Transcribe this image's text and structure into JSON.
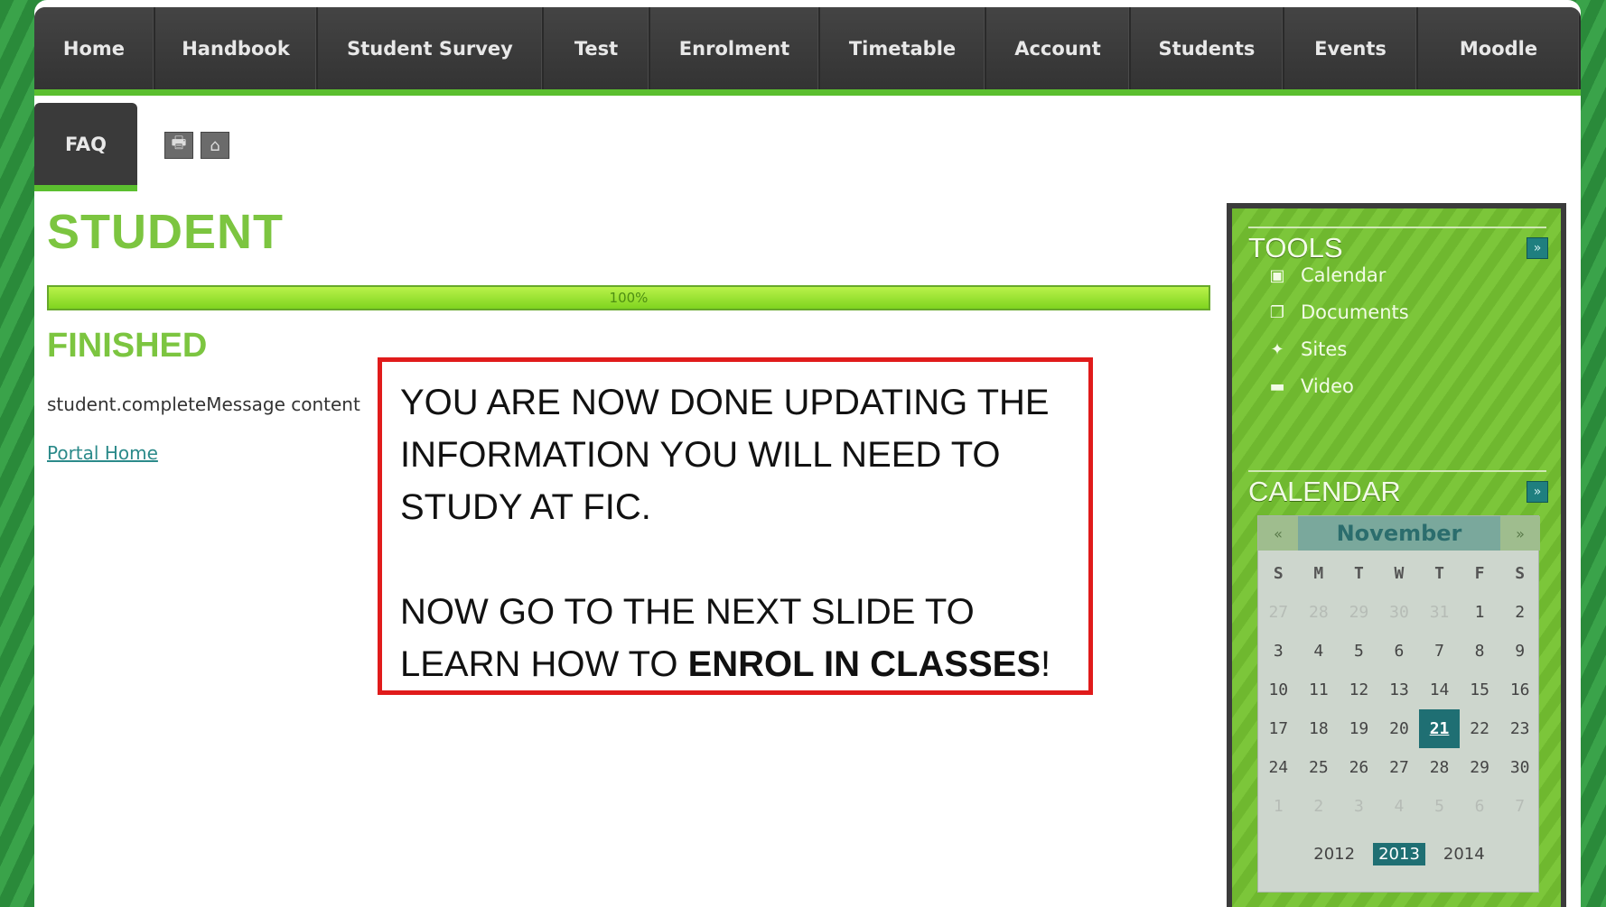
{
  "nav": {
    "items": [
      "Home",
      "Handbook",
      "Student Survey",
      "Test",
      "Enrolment",
      "Timetable",
      "Account",
      "Students",
      "Events",
      "Moodle"
    ]
  },
  "subnav": {
    "faq_label": "FAQ"
  },
  "icons": {
    "print": "printer-icon",
    "home": "home-icon"
  },
  "main": {
    "title": "STUDENT",
    "progress_text": "100%",
    "progress_fraction": 1.0,
    "subtitle": "FINISHED",
    "message": "student.completeMessage content",
    "portal_link": "Portal Home"
  },
  "callout": {
    "line1": "YOU ARE NOW DONE UPDATING THE",
    "line2": "INFORMATION YOU WILL NEED TO",
    "line3": "STUDY AT FIC.",
    "line4": "NOW GO TO THE NEXT SLIDE TO",
    "line5_prefix": "LEARN HOW TO ",
    "line5_bold": "ENROL IN CLASSES",
    "line5_suffix": "!"
  },
  "sidebar": {
    "tools_title": "TOOLS",
    "tools": [
      {
        "label": "Calendar",
        "icon": "calendar-icon",
        "glyph": "▣"
      },
      {
        "label": "Documents",
        "icon": "documents-icon",
        "glyph": "❐"
      },
      {
        "label": "Sites",
        "icon": "sites-icon",
        "glyph": "✦"
      },
      {
        "label": "Video",
        "icon": "video-icon",
        "glyph": "▬"
      }
    ],
    "calendar_title": "CALENDAR",
    "expand_glyph": "»"
  },
  "calendar": {
    "month": "November",
    "prev": "«",
    "next": "»",
    "dow": [
      "S",
      "M",
      "T",
      "W",
      "T",
      "F",
      "S"
    ],
    "weeks": [
      [
        {
          "d": "27",
          "o": true
        },
        {
          "d": "28",
          "o": true
        },
        {
          "d": "29",
          "o": true
        },
        {
          "d": "30",
          "o": true
        },
        {
          "d": "31",
          "o": true
        },
        {
          "d": "1"
        },
        {
          "d": "2"
        }
      ],
      [
        {
          "d": "3"
        },
        {
          "d": "4"
        },
        {
          "d": "5"
        },
        {
          "d": "6"
        },
        {
          "d": "7"
        },
        {
          "d": "8"
        },
        {
          "d": "9"
        }
      ],
      [
        {
          "d": "10"
        },
        {
          "d": "11"
        },
        {
          "d": "12"
        },
        {
          "d": "13"
        },
        {
          "d": "14"
        },
        {
          "d": "15"
        },
        {
          "d": "16"
        }
      ],
      [
        {
          "d": "17"
        },
        {
          "d": "18"
        },
        {
          "d": "19"
        },
        {
          "d": "20"
        },
        {
          "d": "21",
          "t": true
        },
        {
          "d": "22"
        },
        {
          "d": "23"
        }
      ],
      [
        {
          "d": "24"
        },
        {
          "d": "25"
        },
        {
          "d": "26"
        },
        {
          "d": "27"
        },
        {
          "d": "28"
        },
        {
          "d": "29"
        },
        {
          "d": "30"
        }
      ],
      [
        {
          "d": "1",
          "o": true
        },
        {
          "d": "2",
          "o": true
        },
        {
          "d": "3",
          "o": true
        },
        {
          "d": "4",
          "o": true
        },
        {
          "d": "5",
          "o": true
        },
        {
          "d": "6",
          "o": true
        },
        {
          "d": "7",
          "o": true
        }
      ]
    ],
    "years": [
      {
        "y": "2012"
      },
      {
        "y": "2013",
        "sel": true
      },
      {
        "y": "2014"
      }
    ]
  },
  "colors": {
    "accent_green": "#7cc540",
    "nav_bg": "#3a3a3a",
    "teal": "#1f6f73",
    "callout_border": "#e01b1b"
  }
}
